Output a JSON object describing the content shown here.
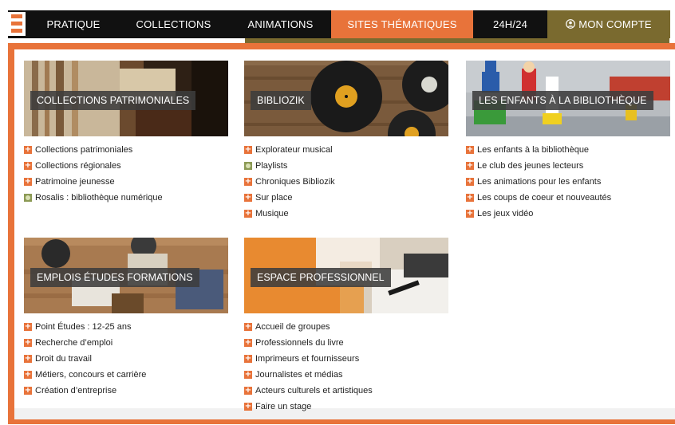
{
  "nav": {
    "items": [
      {
        "label": "PRATIQUE"
      },
      {
        "label": "COLLECTIONS"
      },
      {
        "label": "ANIMATIONS"
      },
      {
        "label": "SITES THÉMATIQUES"
      },
      {
        "label": "24H/24"
      },
      {
        "label": "MON COMPTE"
      }
    ],
    "active": "SITES THÉMATIQUES",
    "account_icon": "user-circle-icon"
  },
  "colors": {
    "accent": "#e8733a",
    "dark": "#111111",
    "olive": "#7a6a2f"
  },
  "cards": [
    {
      "title": "COLLECTIONS PATRIMONIALES",
      "links": [
        {
          "label": "Collections patrimoniales",
          "icon": "plus"
        },
        {
          "label": "Collections régionales",
          "icon": "plus"
        },
        {
          "label": "Patrimoine jeunesse",
          "icon": "plus"
        },
        {
          "label": "Rosalis : bibliothèque numérique",
          "icon": "external"
        }
      ]
    },
    {
      "title": "BIBLIOZIK",
      "links": [
        {
          "label": "Explorateur musical",
          "icon": "plus"
        },
        {
          "label": "Playlists",
          "icon": "external"
        },
        {
          "label": "Chroniques Bibliozik",
          "icon": "plus"
        },
        {
          "label": "Sur place",
          "icon": "plus"
        },
        {
          "label": "Musique",
          "icon": "plus"
        }
      ]
    },
    {
      "title": "LES ENFANTS À LA BIBLIOTHÈQUE",
      "links": [
        {
          "label": "Les enfants à la bibliothèque",
          "icon": "plus"
        },
        {
          "label": "Le club des jeunes lecteurs",
          "icon": "plus"
        },
        {
          "label": "Les animations pour les enfants",
          "icon": "plus"
        },
        {
          "label": "Les coups de coeur et nouveautés",
          "icon": "plus"
        },
        {
          "label": "Les jeux vidéo",
          "icon": "plus"
        }
      ]
    },
    {
      "title": "EMPLOIS ÉTUDES FORMATIONS",
      "links": [
        {
          "label": "Point Études : 12-25 ans",
          "icon": "plus"
        },
        {
          "label": "Recherche d’emploi",
          "icon": "plus"
        },
        {
          "label": "Droit du travail",
          "icon": "plus"
        },
        {
          "label": "Métiers, concours et carrière",
          "icon": "plus"
        },
        {
          "label": "Création d’entreprise",
          "icon": "plus"
        }
      ]
    },
    {
      "title": "ESPACE PROFESSIONNEL",
      "links": [
        {
          "label": "Accueil de groupes",
          "icon": "plus"
        },
        {
          "label": "Professionnels du livre",
          "icon": "plus"
        },
        {
          "label": "Imprimeurs et fournisseurs",
          "icon": "plus"
        },
        {
          "label": "Journalistes et médias",
          "icon": "plus"
        },
        {
          "label": "Acteurs culturels et artistiques",
          "icon": "plus"
        },
        {
          "label": "Faire un stage",
          "icon": "plus"
        }
      ]
    }
  ]
}
